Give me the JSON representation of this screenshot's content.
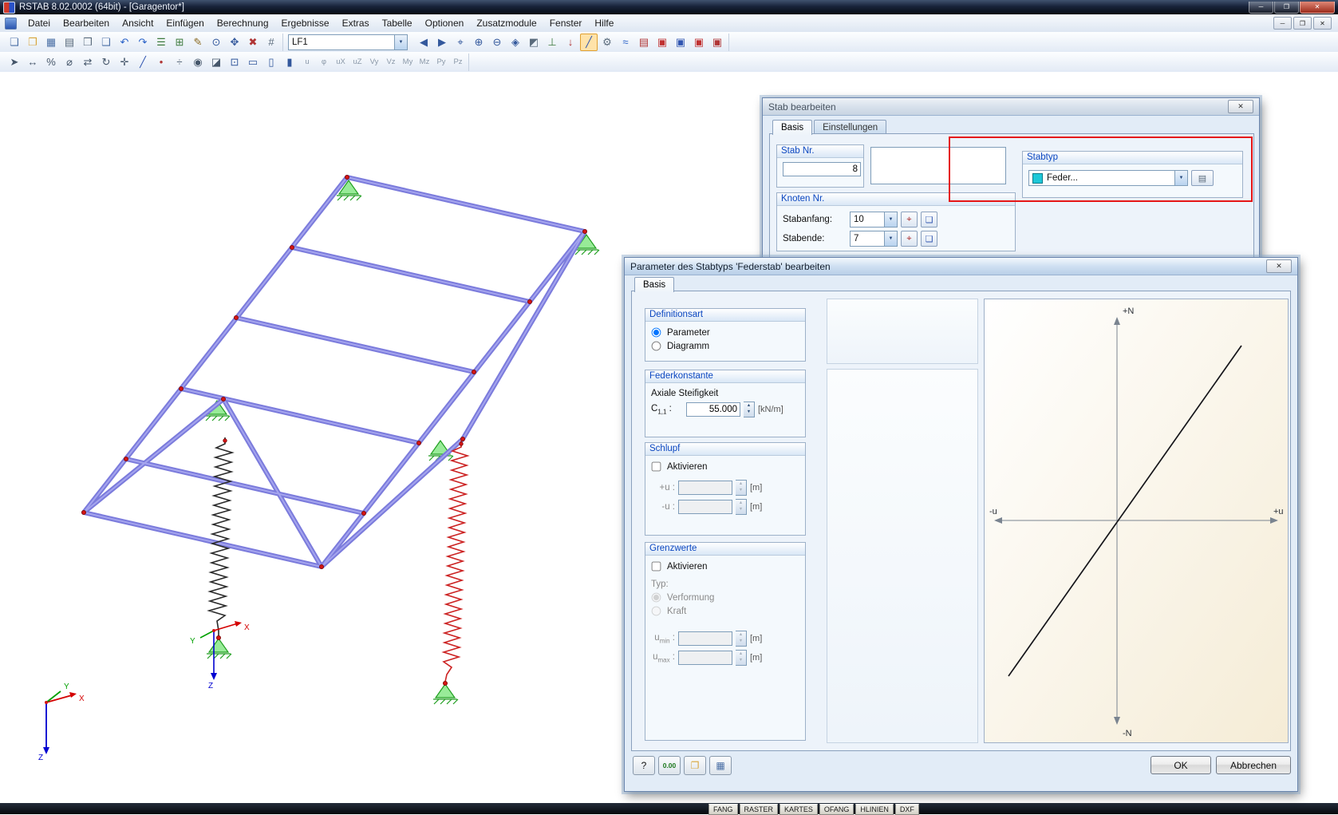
{
  "window": {
    "title": "RSTAB 8.02.0002 (64bit) - [Garagentor*]"
  },
  "glyphs": {
    "close": "✕",
    "minimize": "─",
    "maximize": "❐",
    "dropdown": "▼",
    "spin_up": "▲",
    "spin_down": "▼",
    "pick": "⌖",
    "new_node": "❏",
    "open": "❐",
    "save": "▦",
    "edit_dialog": "▤",
    "help": "?"
  },
  "menu": {
    "items": [
      "Datei",
      "Bearbeiten",
      "Ansicht",
      "Einfügen",
      "Berechnung",
      "Ergebnisse",
      "Extras",
      "Tabelle",
      "Optionen",
      "Zusatzmodule",
      "Fenster",
      "Hilfe"
    ]
  },
  "toolbar1": {
    "loadcase": "LF1",
    "icons_a": [
      {
        "name": "new-file-icon",
        "glyph": "❏",
        "color": "#4a6fa5"
      },
      {
        "name": "open-file-icon",
        "glyph": "❐",
        "color": "#d8a53a"
      },
      {
        "name": "save-icon",
        "glyph": "▦",
        "color": "#4a6fa5"
      },
      {
        "name": "print-icon",
        "glyph": "▤",
        "color": "#5a6b7c"
      },
      {
        "name": "print-preview-icon",
        "glyph": "❒",
        "color": "#5a6b7c"
      },
      {
        "name": "copy-icon",
        "glyph": "❑",
        "color": "#4a6fa5"
      },
      {
        "name": "undo-icon",
        "glyph": "↶",
        "color": "#2a62c8"
      },
      {
        "name": "redo-icon",
        "glyph": "↷",
        "color": "#2a62c8"
      },
      {
        "name": "navigator-icon",
        "glyph": "☰",
        "color": "#3d7a3d"
      },
      {
        "name": "tables-icon",
        "glyph": "⊞",
        "color": "#3d7a3d"
      },
      {
        "name": "edit-pen-icon",
        "glyph": "✎",
        "color": "#8a6a22"
      },
      {
        "name": "zoom-window-icon",
        "glyph": "⊙",
        "color": "#33589c"
      },
      {
        "name": "pan-view-icon",
        "glyph": "✥",
        "color": "#33589c"
      },
      {
        "name": "delete-icon",
        "glyph": "✖",
        "color": "#b03535"
      },
      {
        "name": "snap-grid-icon",
        "glyph": "#",
        "color": "#5a6b7c"
      }
    ],
    "icons_b": [
      {
        "name": "previous-loadcase-icon",
        "glyph": "◀",
        "color": "#33589c"
      },
      {
        "name": "next-loadcase-icon",
        "glyph": "▶",
        "color": "#33589c"
      },
      {
        "name": "find-node-icon",
        "glyph": "⌖",
        "color": "#33589c"
      },
      {
        "name": "zoom-in-icon",
        "glyph": "⊕",
        "color": "#33589c"
      },
      {
        "name": "zoom-out-icon",
        "glyph": "⊖",
        "color": "#33589c"
      },
      {
        "name": "isometric-view-icon",
        "glyph": "◈",
        "color": "#33589c"
      },
      {
        "name": "render-model-icon",
        "glyph": "◩",
        "color": "#5a6b7c"
      },
      {
        "name": "show-supports-icon",
        "glyph": "⊥",
        "color": "#3d7a3d"
      },
      {
        "name": "show-loads-icon",
        "glyph": "↓",
        "color": "#b03535"
      },
      {
        "name": "edit-member-icon",
        "glyph": "╱",
        "color": "#3055b0",
        "active": true
      },
      {
        "name": "calculation-icon",
        "glyph": "⚙",
        "color": "#5a6b7c"
      },
      {
        "name": "show-results-icon",
        "glyph": "≈",
        "color": "#2a62c8"
      },
      {
        "name": "printout-report-icon",
        "glyph": "▤",
        "color": "#b03535"
      },
      {
        "name": "module-addon1-icon",
        "glyph": "▣",
        "color": "#c03030"
      },
      {
        "name": "module-addon2-icon",
        "glyph": "▣",
        "color": "#3055b0"
      },
      {
        "name": "module-addon3-icon",
        "glyph": "▣",
        "color": "#c03030"
      },
      {
        "name": "export-pdf-icon",
        "glyph": "▣",
        "color": "#b03535"
      }
    ]
  },
  "toolbar2": {
    "icons": [
      {
        "name": "select-mode-icon",
        "glyph": "➤",
        "color": "#45566a"
      },
      {
        "name": "dimension-icon",
        "glyph": "↔",
        "color": "#45566a"
      },
      {
        "name": "percent-snap-icon",
        "glyph": "%",
        "color": "#45566a"
      },
      {
        "name": "measure-icon",
        "glyph": "⌀",
        "color": "#45566a"
      },
      {
        "name": "mirror-icon",
        "glyph": "⇄",
        "color": "#45566a"
      },
      {
        "name": "rotate-icon",
        "glyph": "↻",
        "color": "#45566a"
      },
      {
        "name": "move-icon",
        "glyph": "✛",
        "color": "#45566a"
      },
      {
        "name": "new-member-icon",
        "glyph": "╱",
        "color": "#3055b0"
      },
      {
        "name": "new-node-icon",
        "glyph": "•",
        "color": "#b03535"
      },
      {
        "name": "divide-member-icon",
        "glyph": "÷",
        "color": "#45566a"
      },
      {
        "name": "visibility-icon",
        "glyph": "◉",
        "color": "#45566a"
      },
      {
        "name": "partial-view-icon",
        "glyph": "◪",
        "color": "#45566a"
      },
      {
        "name": "zoom-full-icon",
        "glyph": "⊡",
        "color": "#33589c"
      },
      {
        "name": "view-xy-icon",
        "glyph": "▭",
        "color": "#33589c"
      },
      {
        "name": "view-xz-icon",
        "glyph": "▯",
        "color": "#33589c"
      },
      {
        "name": "view-yz-icon",
        "glyph": "▮",
        "color": "#33589c"
      },
      {
        "name": "result-u-toggle",
        "glyph": "u",
        "color": "#8a98a8",
        "small": true
      },
      {
        "name": "result-phi-toggle",
        "glyph": "φ",
        "color": "#8a98a8",
        "small": true
      },
      {
        "name": "result-ux-toggle",
        "glyph": "uX",
        "color": "#8a98a8",
        "small": true
      },
      {
        "name": "result-uz-toggle",
        "glyph": "uZ",
        "color": "#8a98a8",
        "small": true
      },
      {
        "name": "result-vy-toggle",
        "glyph": "Vy",
        "color": "#8a98a8",
        "small": true
      },
      {
        "name": "result-vz-toggle",
        "glyph": "Vz",
        "color": "#8a98a8",
        "small": true
      },
      {
        "name": "result-my-toggle",
        "glyph": "My",
        "color": "#8a98a8",
        "small": true
      },
      {
        "name": "result-mz-toggle",
        "glyph": "Mz",
        "color": "#8a98a8",
        "small": true
      },
      {
        "name": "result-py-toggle",
        "glyph": "Py",
        "color": "#8a98a8",
        "small": true
      },
      {
        "name": "result-pz-toggle",
        "glyph": "Pz",
        "color": "#8a98a8",
        "small": true
      }
    ]
  },
  "canvas": {
    "axes": {
      "x": "X",
      "y": "Y",
      "z": "Z"
    }
  },
  "dialog_stab": {
    "title": "Stab bearbeiten",
    "tabs": [
      "Basis",
      "Einstellungen"
    ],
    "groups": {
      "stab_nr": {
        "caption": "Stab Nr.",
        "value": "8"
      },
      "knoten": {
        "caption": "Knoten Nr.",
        "stabanfang_label": "Stabanfang:",
        "stabanfang_value": "10",
        "stabende_label": "Stabende:",
        "stabende_value": "7"
      },
      "stabtyp": {
        "caption": "Stabtyp",
        "value": "Feder...",
        "swatch_style": "background:#1ec8d8"
      }
    }
  },
  "dialog_feder": {
    "title": "Parameter des Stabtyps 'Federstab' bearbeiten",
    "tab": "Basis",
    "definitionsart": {
      "caption": "Definitionsart",
      "parameter": "Parameter",
      "diagramm": "Diagramm"
    },
    "federkonstante": {
      "caption": "Federkonstante",
      "sublabel": "Axiale Steifigkeit",
      "c_base": "C",
      "c_sub": "1,1",
      "colon": ":",
      "value": "55.000",
      "unit": "[kN/m]"
    },
    "schlupf": {
      "caption": "Schlupf",
      "aktivieren": "Aktivieren",
      "plus_u": "+u :",
      "minus_u": "-u :",
      "unit": "[m]"
    },
    "grenzwerte": {
      "caption": "Grenzwerte",
      "aktivieren": "Aktivieren",
      "typ": "Typ:",
      "verformung": "Verformung",
      "kraft": "Kraft",
      "u_base": "u",
      "min_sub": "min",
      "max_sub": "max",
      "colon": ":",
      "unit": "[m]"
    },
    "diagram": {
      "top": "+N",
      "bottom": "-N",
      "left": "-u",
      "right": "+u"
    },
    "buttons": {
      "ok": "OK",
      "cancel": "Abbrechen",
      "help": "?",
      "units": "0.00"
    }
  },
  "statusbar": {
    "toggles": [
      "FANG",
      "RASTER",
      "KARTES",
      "OFANG",
      "HLINIEN",
      "DXF"
    ]
  }
}
